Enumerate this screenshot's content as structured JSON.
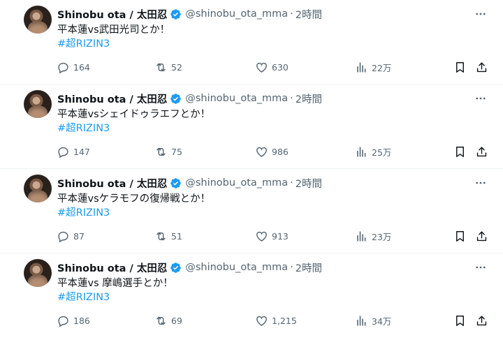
{
  "colors": {
    "text": "#0f1419",
    "secondary": "#536471",
    "accent": "#1d9bf0",
    "divider": "#eff3f4"
  },
  "tweets": [
    {
      "name": "Shinobu ota / 太田忍",
      "handle": "@shinobu_ota_mma",
      "dot": "·",
      "time": "2時間",
      "text": "平本蓮vs武田光司とか！",
      "hashtag": "#超RIZIN3",
      "replies": "164",
      "retweets": "52",
      "likes": "630",
      "views": "22万"
    },
    {
      "name": "Shinobu ota / 太田忍",
      "handle": "@shinobu_ota_mma",
      "dot": "·",
      "time": "2時間",
      "text": "平本蓮vsシェイドゥラエフとか！",
      "hashtag": "#超RIZIN3",
      "replies": "147",
      "retweets": "75",
      "likes": "986",
      "views": "25万"
    },
    {
      "name": "Shinobu ota / 太田忍",
      "handle": "@shinobu_ota_mma",
      "dot": "·",
      "time": "2時間",
      "text": "平本蓮vsケラモフの復帰戦とか！",
      "hashtag": "#超RIZIN3",
      "replies": "87",
      "retweets": "51",
      "likes": "913",
      "views": "23万"
    },
    {
      "name": "Shinobu ota / 太田忍",
      "handle": "@shinobu_ota_mma",
      "dot": "·",
      "time": "2時間",
      "text": "平本蓮vs 摩嶋選手とか！",
      "hashtag": "#超RIZIN3",
      "replies": "186",
      "retweets": "69",
      "likes": "1,215",
      "views": "34万"
    }
  ]
}
